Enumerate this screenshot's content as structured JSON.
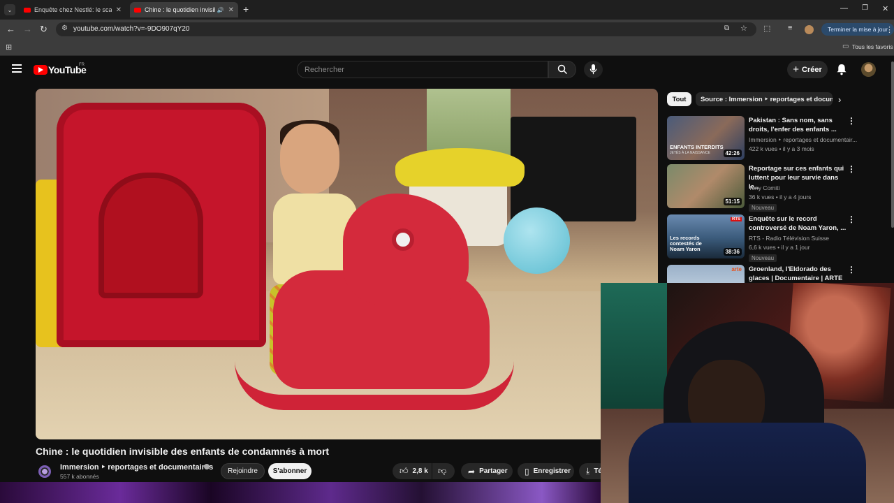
{
  "browser": {
    "tabs": [
      {
        "title": "Enquête chez Nestlé: le scandale",
        "active": false
      },
      {
        "title": "Chine : le quotidien invisible des",
        "active": true
      }
    ],
    "url": "youtube.com/watch?v=-9DO907qY20",
    "update_button": "Terminer la mise à jour",
    "bookmarks_label": "Tous les favoris"
  },
  "youtube": {
    "logo_text": "YouTube",
    "logo_region": "FR",
    "search_placeholder": "Rechercher",
    "create_label": "Créer"
  },
  "video": {
    "title": "Chine : le quotidien invisible des enfants de condamnés à mort",
    "channel": "Immersion ‣ reportages et documentaires",
    "subscribers": "557 k abonnés",
    "join_label": "Rejoindre",
    "subscribe_label": "S'abonner",
    "likes": "2,8 k",
    "share_label": "Partager",
    "save_label": "Enregistrer",
    "download_label": "Té"
  },
  "sidebar": {
    "chips": [
      "Tout",
      "Source : Immersion ‣ reportages et documentaires"
    ],
    "recommendations": [
      {
        "title": "Pakistan : Sans nom, sans droits, l'enfer des enfants ...",
        "channel": "Immersion ‣ reportages et documentair...",
        "meta": "422 k vues • il y a 3 mois",
        "duration": "42:26",
        "thumb_text": "ENFANTS INTERDITS",
        "thumb_subtext": "JETÉS À LA NAISSANCE",
        "badge": ""
      },
      {
        "title": "Reportage sur ces enfants qui luttent pour leur survie dans le...",
        "channel": "Tony Comiti",
        "meta": "36 k vues • il y a 4 jours",
        "duration": "51:15",
        "thumb_text": "",
        "thumb_subtext": "",
        "badge": "Nouveau"
      },
      {
        "title": "Enquête sur le record controversé de Noam Yaron, ...",
        "channel": "RTS - Radio Télévision Suisse",
        "meta": "6,6 k vues • il y a 1 jour",
        "duration": "38:36",
        "thumb_text": "Les records contestés de Noam Yaron",
        "thumb_subtext": "RTS",
        "badge": "Nouveau"
      },
      {
        "title": "Groenland, l'Eldorado des glaces | Documentaire | ARTE",
        "channel": "",
        "meta": "",
        "duration": "",
        "thumb_text": "arte",
        "thumb_subtext": "",
        "badge": ""
      }
    ]
  },
  "colors": {
    "yt_red": "#ff0000",
    "background": "#0f0f0f",
    "chip_active": "#f1f1f1"
  },
  "icons": [
    "menu-icon",
    "search-icon",
    "mic-icon",
    "bell-icon",
    "like-icon",
    "dislike-icon",
    "share-icon",
    "save-icon",
    "download-icon",
    "more-vert-icon"
  ]
}
